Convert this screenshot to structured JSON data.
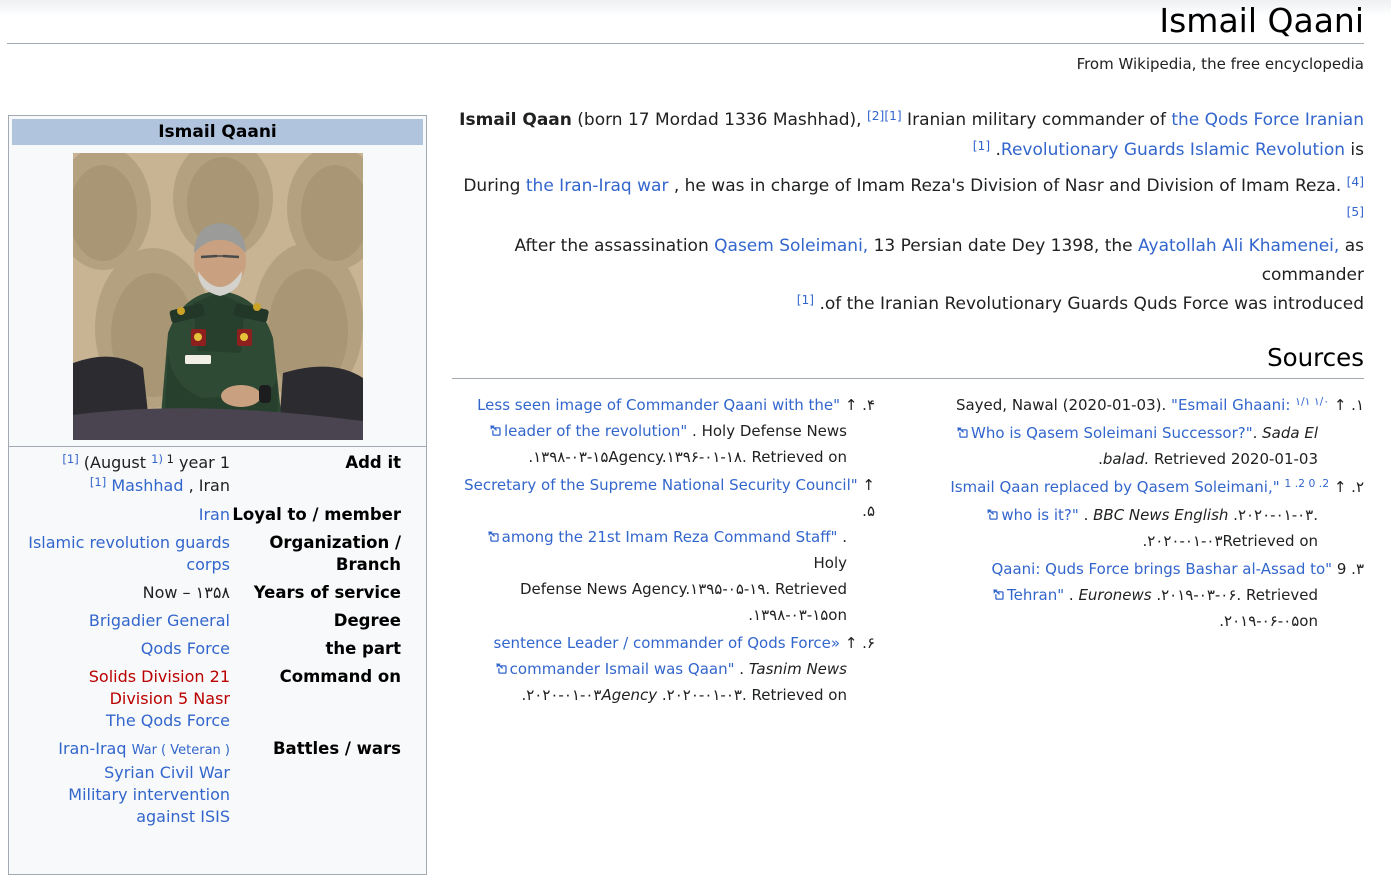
{
  "page": {
    "title": "Ismail Qaani",
    "subtitle": "From Wikipedia, the free encyclopedia"
  },
  "colors": {
    "link_blue": "#3366cc",
    "redlink": "#ba0000",
    "infobox_header": "#b0c4de",
    "border_gray": "#a2a9b1"
  },
  "infobox": {
    "title": "Ismail Qaani",
    "photo": "portrait of Ismail Qaani in green IRGC uniform among tan auditorium chairs",
    "rows": [
      {
        "label": "Add it",
        "lines": [
          [
            {
              "t": "[1]",
              "s": "sup lk"
            },
            {
              "t": " (August ",
              "s": ""
            },
            {
              "t": "1)",
              "s": "sup lk"
            },
            {
              "t": " 1",
              "s": "sup"
            },
            {
              "t": " year 1",
              "s": ""
            }
          ],
          [
            {
              "t": "[1]",
              "s": "sup lk"
            },
            {
              "t": " ",
              "s": ""
            },
            {
              "t": "Mashhad",
              "s": "lk"
            },
            {
              "t": " , Iran",
              "s": ""
            }
          ]
        ]
      },
      {
        "label": "Loyal to / member",
        "lines": [
          [
            {
              "t": "Iran",
              "s": "lk"
            }
          ]
        ]
      },
      {
        "label": "Organization / Branch",
        "lines": [
          [
            {
              "t": "Islamic revolution guards corps",
              "s": "lk"
            }
          ]
        ]
      },
      {
        "label": "Years of service",
        "lines": [
          [
            {
              "t": "Now – ۱۳۵۸",
              "s": ""
            }
          ]
        ]
      },
      {
        "label": "Degree",
        "lines": [
          [
            {
              "t": "Brigadier General",
              "s": "lk"
            }
          ]
        ]
      },
      {
        "label": "the part",
        "lines": [
          [
            {
              "t": "Qods Force",
              "s": "lk"
            }
          ]
        ]
      },
      {
        "label": "Command on",
        "lines": [
          [
            {
              "t": "Solids Division 21",
              "s": "rd"
            }
          ],
          [
            {
              "t": "Division 5 Nasr",
              "s": "rd"
            }
          ],
          [
            {
              "t": "The Qods Force",
              "s": "lk"
            }
          ]
        ]
      },
      {
        "label": "Battles / wars",
        "lines": [
          [
            {
              "t": "Iran-Iraq",
              "s": "lk"
            },
            {
              "t": " ",
              "s": ""
            },
            {
              "t": "War ( Veteran )",
              "s": "lk sm"
            }
          ],
          [
            {
              "t": "Syrian Civil War",
              "s": "lk"
            }
          ],
          [
            {
              "t": "Military intervention against ISIS",
              "s": "lk"
            }
          ]
        ]
      }
    ]
  },
  "article": {
    "sources_heading": "Sources",
    "paragraphs": [
      {
        "lines": [
          [
            {
              "t": "Ismail Qaan",
              "s": "b"
            },
            {
              "t": " (born 17 Mordad 1336 Mashhad), ",
              "s": ""
            },
            {
              "t": "[2][1]",
              "s": "sup lk"
            },
            {
              "t": " Iranian military commander of ",
              "s": ""
            },
            {
              "t": "the Qods Force Iranian",
              "s": "lk"
            }
          ],
          [
            {
              "t": "[1]",
              "s": "sup lk"
            },
            {
              "t": " .",
              "s": ""
            },
            {
              "t": "Revolutionary Guards Islamic Revolution",
              "s": "lk"
            },
            {
              "t": " is",
              "s": ""
            }
          ]
        ]
      },
      {
        "lines": [
          [
            {
              "t": "During ",
              "s": ""
            },
            {
              "t": "the Iran-Iraq war",
              "s": "lk"
            },
            {
              "t": " , he was in charge of Imam Reza's Division of Nasr and Division of Imam Reza. ",
              "s": ""
            },
            {
              "t": "[4][5]",
              "s": "sup lk"
            }
          ],
          [
            {
              "t": "After the assassination ",
              "s": ""
            },
            {
              "t": "Qasem Soleimani,",
              "s": "lk"
            },
            {
              "t": " 13 Persian date Dey 1398, the ",
              "s": ""
            },
            {
              "t": "Ayatollah Ali Khamenei,",
              "s": "lk"
            },
            {
              "t": " as commander",
              "s": ""
            }
          ],
          [
            {
              "t": "[1]",
              "s": "sup lk"
            },
            {
              "t": " .of the Iranian Revolutionary Guards Quds Force was introduced",
              "s": ""
            }
          ]
        ]
      }
    ]
  },
  "references": {
    "right_column": [
      {
        "lines": [
          [
            {
              "t": "Sayed, Nawal (2020-01-03). ",
              "s": ""
            },
            {
              "t": "\"Esmail Ghaani: ",
              "s": "lk"
            },
            {
              "t": "۱/۱ ۱/۰",
              "s": "sup lk"
            },
            {
              "t": " ↑",
              "s": "up"
            },
            {
              "t": " .۱",
              "s": "mk"
            }
          ],
          [
            {
              "s": "ic"
            },
            {
              "t": "Who is Qasem Soleimani Successor?\"",
              "s": "lk"
            },
            {
              "t": ". ",
              "s": ""
            },
            {
              "t": "Sada El",
              "s": "it"
            }
          ],
          [
            {
              "t": ".",
              "s": ""
            },
            {
              "t": "balad.",
              "s": "it"
            },
            {
              "t": " Retrieved 2020-01-03",
              "s": ""
            }
          ]
        ]
      },
      {
        "lines": [
          [
            {
              "t": "Ismail Qaan replaced by Qasem Soleimani,\"",
              "s": "lk"
            },
            {
              "t": " ",
              "s": ""
            },
            {
              "t": "1 .2 0 .2",
              "s": "sup lk"
            },
            {
              "t": " ↑",
              "s": "up"
            },
            {
              "t": " .۲",
              "s": "mk"
            }
          ],
          [
            {
              "s": "ic"
            },
            {
              "t": "who is it?\"",
              "s": "lk"
            },
            {
              "t": " . ",
              "s": ""
            },
            {
              "t": "BBC News English",
              "s": "it"
            },
            {
              "t": " .۲۰۲۰-۰۱-۰۳.",
              "s": ""
            }
          ],
          [
            {
              "t": ".۲۰۲۰-۰۱-۰۳Retrieved on",
              "s": ""
            }
          ]
        ]
      },
      {
        "lines": [
          [
            {
              "t": "Qaani: Quds Force brings Bashar al-Assad to\"",
              "s": "lk"
            },
            {
              "t": " 9",
              "s": "up"
            },
            {
              "t": " .۳",
              "s": "mk"
            }
          ],
          [
            {
              "s": "ic"
            },
            {
              "t": "Tehran\"",
              "s": "lk"
            },
            {
              "t": " . ",
              "s": ""
            },
            {
              "t": "Euronews",
              "s": "it"
            },
            {
              "t": " .۲۰۱۹-۰۳-۰۶. Retrieved",
              "s": ""
            }
          ],
          [
            {
              "t": ".۲۰۱۹-۰۶-۰۵on",
              "s": ""
            }
          ]
        ]
      }
    ],
    "left_column": [
      {
        "lines": [
          [
            {
              "t": "Less seen image of Commander Qaani with the\"",
              "s": "lk"
            },
            {
              "t": " ↑",
              "s": "up"
            },
            {
              "t": " .۴",
              "s": "mk"
            }
          ],
          [
            {
              "s": "ic"
            },
            {
              "t": "leader of the revolution\"",
              "s": "lk"
            },
            {
              "t": " . Holy Defense News",
              "s": ""
            }
          ],
          [
            {
              "t": ".۱۳۹۸-۰۳-۱۵Agency.۱۳۹۶-۰۱-۱۸. Retrieved on",
              "s": ""
            }
          ]
        ]
      },
      {
        "lines": [
          [
            {
              "t": "Secretary of the Supreme National Security Council\"",
              "s": "lk"
            },
            {
              "t": " ↑",
              "s": "up"
            },
            {
              "t": " .۵",
              "s": "mk"
            }
          ],
          [
            {
              "s": "ic"
            },
            {
              "t": "among the 21st Imam Reza Command Staff\"",
              "s": "lk"
            },
            {
              "t": " . Holy",
              "s": ""
            }
          ],
          [
            {
              "t": "Defense News Agency.۱۳۹۵-۰۵-۱۹. Retrieved",
              "s": ""
            }
          ],
          [
            {
              "t": ".۱۳۹۸-۰۳-۱۵on",
              "s": ""
            }
          ]
        ]
      },
      {
        "lines": [
          [
            {
              "t": "sentence Leader / commander of Qods Force»",
              "s": "lk"
            },
            {
              "t": " ↑",
              "s": "up"
            },
            {
              "t": " .۶",
              "s": "mk"
            }
          ],
          [
            {
              "s": "ic"
            },
            {
              "t": "commander Ismail was Qaan\"",
              "s": "lk"
            },
            {
              "t": " . ",
              "s": ""
            },
            {
              "t": "Tasnim News",
              "s": "it"
            }
          ],
          [
            {
              "t": ".۲۰۲۰-۰۱-۰۳",
              "s": ""
            },
            {
              "t": "Agency",
              "s": "it"
            },
            {
              "t": " .۲۰۲۰-۰۱-۰۳. Retrieved on",
              "s": ""
            }
          ]
        ]
      }
    ]
  }
}
